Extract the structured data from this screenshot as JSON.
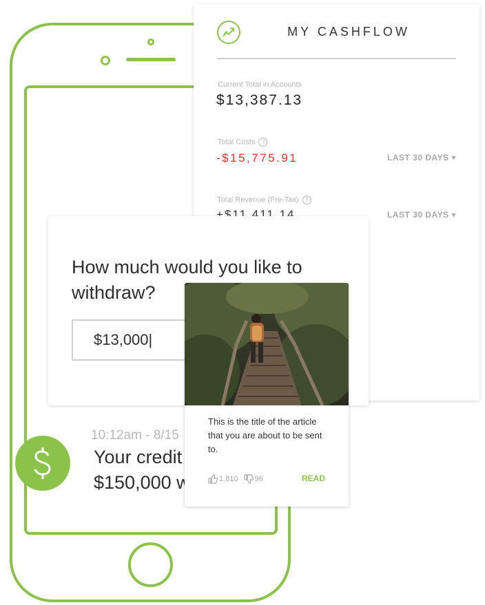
{
  "cashflow": {
    "title": "MY CASHFLOW",
    "current_total_label": "Current Total in Accounts",
    "current_total_value": "$13,387.13",
    "total_costs_label": "Total Costs",
    "total_costs_value": "-$15,775.91",
    "total_costs_range": "LAST 30 DAYS ▾",
    "total_revenue_label": "Total Revenue (Pre-Tax)",
    "total_revenue_value": "+$11,411.14",
    "total_revenue_range": "LAST 30 DAYS ▾"
  },
  "withdraw": {
    "question": "How much would you like to withdraw?",
    "amount_value": "$13,000|"
  },
  "notification": {
    "time": "10:12am - 8/15",
    "text_line1": "Your credit",
    "text_line2": "$150,000 w"
  },
  "article": {
    "title": "This is the title of the article that you are about to be sent to.",
    "likes": "1,810",
    "dislikes": "96",
    "read_label": "READ"
  },
  "colors": {
    "accent": "#8bc34a",
    "negative": "#e0312b"
  },
  "icons": [
    "trend-up-icon",
    "help-icon",
    "dollar-icon",
    "thumbs-up-icon",
    "thumbs-down-icon"
  ]
}
